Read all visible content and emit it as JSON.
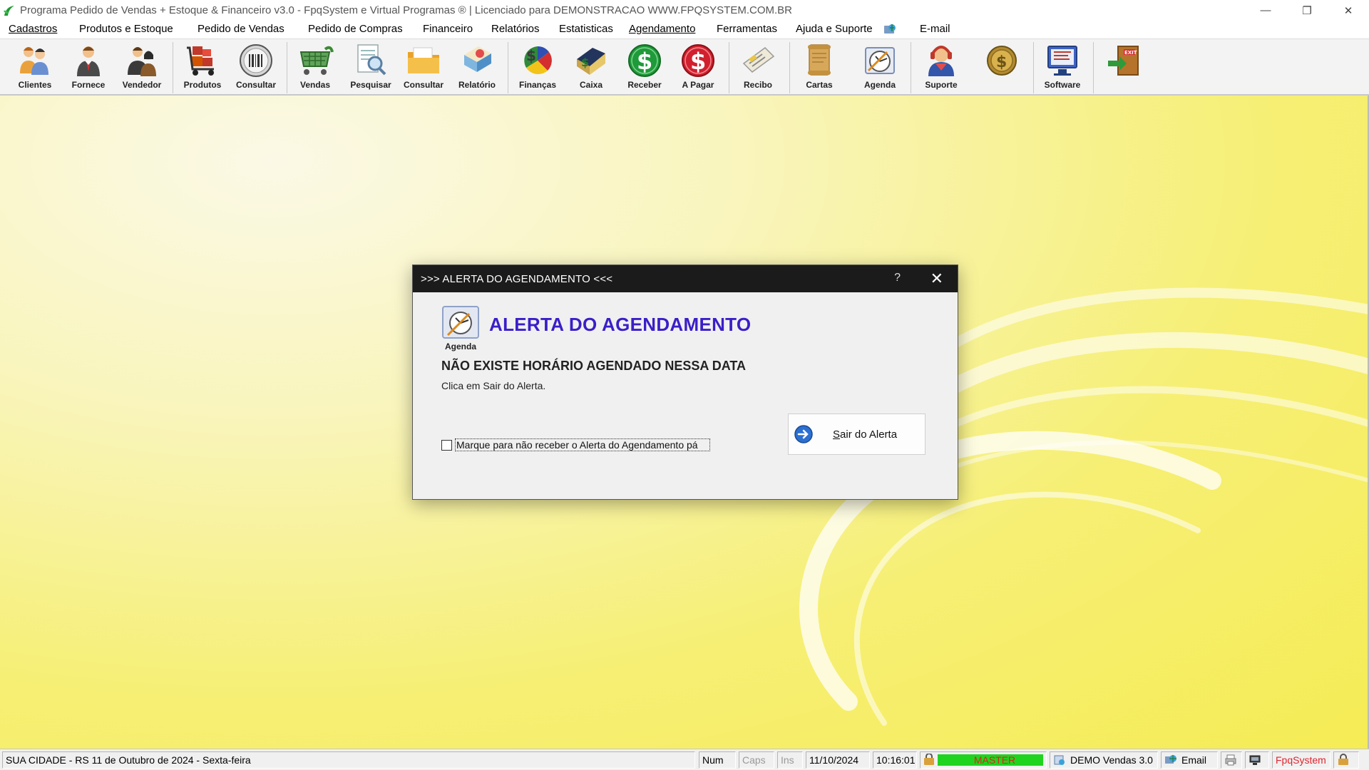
{
  "window": {
    "title": "Programa Pedido de Vendas + Estoque & Financeiro v3.0 - FpqSystem e Virtual Programas ® | Licenciado para  DEMONSTRACAO WWW.FPQSYSTEM.COM.BR",
    "minimize": "—",
    "restore": "❐",
    "close": "✕"
  },
  "menu": [
    {
      "label": "Cadastros"
    },
    {
      "label": "Produtos e Estoque"
    },
    {
      "label": "Pedido de Vendas"
    },
    {
      "label": "Pedido de Compras"
    },
    {
      "label": "Financeiro"
    },
    {
      "label": "Relatórios"
    },
    {
      "label": "Estatisticas"
    },
    {
      "label": "Agendamento"
    },
    {
      "label": "Ferramentas"
    },
    {
      "label": "Ajuda e Suporte"
    },
    {
      "label": "E-mail"
    }
  ],
  "toolbar": [
    {
      "label": "Clientes",
      "icon": "clients-icon"
    },
    {
      "label": "Fornece",
      "icon": "supplier-icon"
    },
    {
      "label": "Vendedor",
      "icon": "seller-icon"
    },
    {
      "label": "Produtos",
      "icon": "products-icon"
    },
    {
      "label": "Consultar",
      "icon": "barcode-icon"
    },
    {
      "label": "Vendas",
      "icon": "cart-icon"
    },
    {
      "label": "Pesquisar",
      "icon": "search-document-icon"
    },
    {
      "label": "Consultar",
      "icon": "folder-icon"
    },
    {
      "label": "Relatório",
      "icon": "report-icon"
    },
    {
      "label": "Finanças",
      "icon": "finance-icon"
    },
    {
      "label": "Caixa",
      "icon": "cash-register-icon"
    },
    {
      "label": "Receber",
      "icon": "receive-money-icon"
    },
    {
      "label": "A Pagar",
      "icon": "pay-money-icon"
    },
    {
      "label": "Recibo",
      "icon": "receipt-icon"
    },
    {
      "label": "Cartas",
      "icon": "letters-icon"
    },
    {
      "label": "Agenda",
      "icon": "agenda-icon"
    },
    {
      "label": "Suporte",
      "icon": "support-icon"
    },
    {
      "label": "",
      "icon": "coin-icon"
    },
    {
      "label": "Software",
      "icon": "software-icon"
    },
    {
      "label": "",
      "icon": "exit-icon"
    }
  ],
  "dialog": {
    "title": ">>> ALERTA DO AGENDAMENTO <<<",
    "help": "?",
    "close": "✕",
    "icon_label": "Agenda",
    "heading": "ALERTA DO AGENDAMENTO",
    "message": "NÃO EXISTE HORÁRIO AGENDADO NESSA DATA",
    "sub": "Clica em Sair do Alerta.",
    "checkbox_label": "Marque para não receber o Alerta do Agendamento pá",
    "checkbox_checked": false,
    "button_label_first": "S",
    "button_label_rest": "air do Alerta"
  },
  "status": {
    "location_date": "SUA CIDADE - RS 11 de Outubro de 2024 - Sexta-feira",
    "num": "Num",
    "caps": "Caps",
    "ins": "Ins",
    "date": "11/10/2024",
    "time": "10:16:01",
    "user": "MASTER",
    "version": "DEMO Vendas 3.0",
    "email": "Email",
    "brand": "FpqSystem"
  },
  "colors": {
    "dialog_heading": "#3b1ec8",
    "brand_red": "#e0242e",
    "master_green": "#1fd41f",
    "master_text": "#d42a1c"
  }
}
